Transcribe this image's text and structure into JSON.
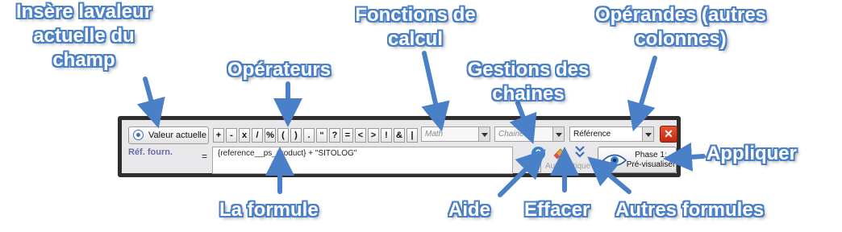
{
  "toolbar": {
    "valeur_button": "Valeur actuelle",
    "operators": [
      "+",
      "-",
      "x",
      "/",
      "%",
      "(",
      ")",
      ".",
      "“",
      "?",
      "=",
      "<",
      ">",
      "!",
      "&",
      "|"
    ],
    "math_combo": "Math",
    "chaines_combo": "Chaines",
    "reference_combo": "Référence",
    "close_label": "✕",
    "field_label": "Réf. fourn.",
    "equals": "=",
    "formula": "{reference__ps_product}  + \"SITOLOG\"",
    "help_label": "?",
    "more_label": "»",
    "automatique_label": "Automatique",
    "preview_line1": "Phase 1:",
    "preview_line2": "Pré-visualiser",
    "accent_color": "#4a80c8"
  },
  "callouts": {
    "insere": "Insère lavaleur actuelle du champ",
    "operateurs": "Opérateurs",
    "fonctions": "Fonctions de calcul",
    "gestions": "Gestions des chaines",
    "operandes": "Opérandes (autres colonnes)",
    "appliquer": "Appliquer",
    "formule": "La formule",
    "aide": "Aide",
    "effacer": "Effacer",
    "autres": "Autres formules"
  }
}
